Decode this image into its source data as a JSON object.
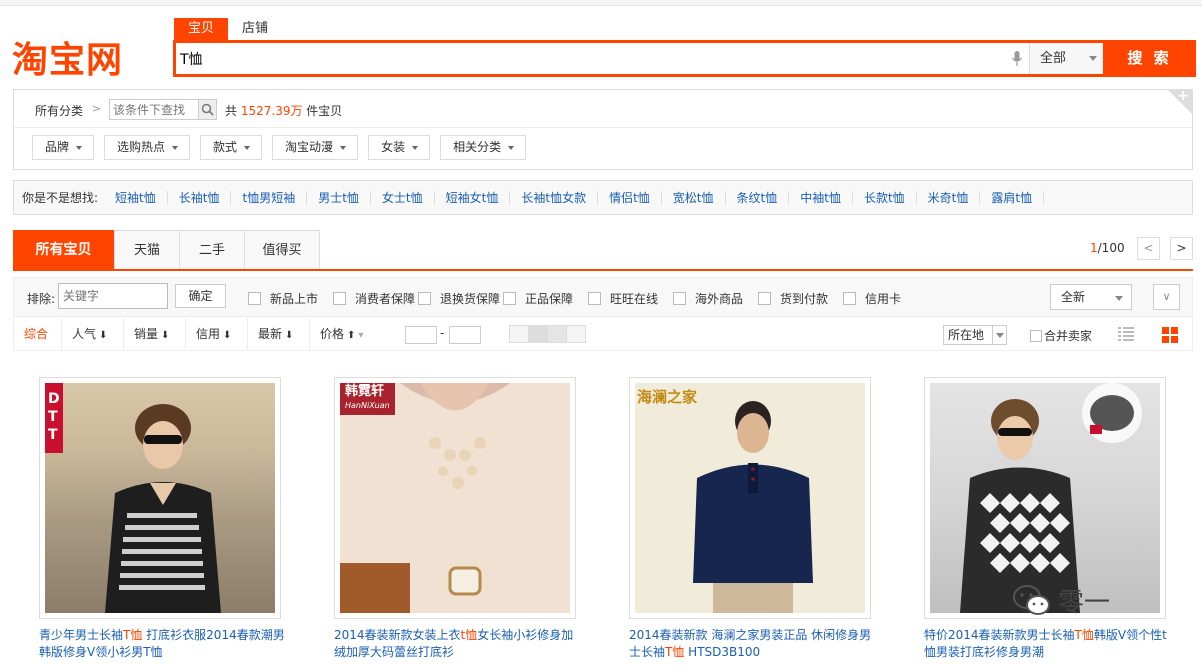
{
  "logo": {
    "text": "淘宝网"
  },
  "search": {
    "tabs": [
      "宝贝",
      "店铺"
    ],
    "query": "T恤",
    "scope": "全部",
    "button_label": "搜 索"
  },
  "category": {
    "all_label": "所有分类",
    "filter_placeholder": "该条件下查找",
    "total_prefix": "共",
    "total_count": "1527.39万",
    "total_suffix": "件宝贝",
    "filters": [
      "品牌",
      "选购热点",
      "款式",
      "淘宝动漫",
      "女装",
      "相关分类"
    ]
  },
  "suggest": {
    "label": "你是不是想找:",
    "items": [
      "短袖t恤",
      "长袖t恤",
      "t恤男短袖",
      "男士t恤",
      "女士t恤",
      "短袖女t恤",
      "长袖t恤女款",
      "情侣t恤",
      "宽松t恤",
      "条纹t恤",
      "中袖t恤",
      "长款t恤",
      "米奇t恤",
      "露肩t恤"
    ]
  },
  "main_tabs": [
    "所有宝贝",
    "天猫",
    "二手",
    "值得买"
  ],
  "pagination": {
    "current": "1",
    "total": "/100"
  },
  "filter_row": {
    "exclude_label": "排除:",
    "exclude_placeholder": "关键字",
    "confirm": "确定",
    "checks": [
      "新品上市",
      "消费者保障",
      "退换货保障",
      "正品保障",
      "旺旺在线",
      "海外商品",
      "货到付款",
      "信用卡"
    ],
    "sort_select": "全新"
  },
  "sort_row": {
    "items": [
      "综合",
      "人气",
      "销量",
      "信用",
      "最新",
      "价格"
    ],
    "price_dash": "-",
    "location": "所在地",
    "merge": "合并卖家"
  },
  "products": [
    {
      "brand": "DTT",
      "title_pre": "青少年男士长袖",
      "title_hl": "T恤",
      "title_post": " 打底衫衣服2014春款潮男韩版修身V领小衫男T恤"
    },
    {
      "brand": "韩霓轩",
      "brand_sub": "HanNiXuan",
      "title_pre": "2014春装新款女装上衣",
      "title_hl": "t恤",
      "title_post": "女长袖小衫修身加绒加厚大码蕾丝打底衫"
    },
    {
      "brand": "海澜之家",
      "title_pre": "2014春装新款 海澜之家男装正品 休闲修身男士长袖",
      "title_hl": "T恤",
      "title_post": " HTSD3B100"
    },
    {
      "brand": "",
      "title_pre": "特价2014春装新款男士长袖",
      "title_hl": "T恤",
      "title_post": "韩版V领个性t恤男装打底衫修身男潮"
    }
  ],
  "watermark": {
    "text": "零一"
  },
  "colors": {
    "accent": "#ff4400",
    "link": "#1a5fb4"
  }
}
